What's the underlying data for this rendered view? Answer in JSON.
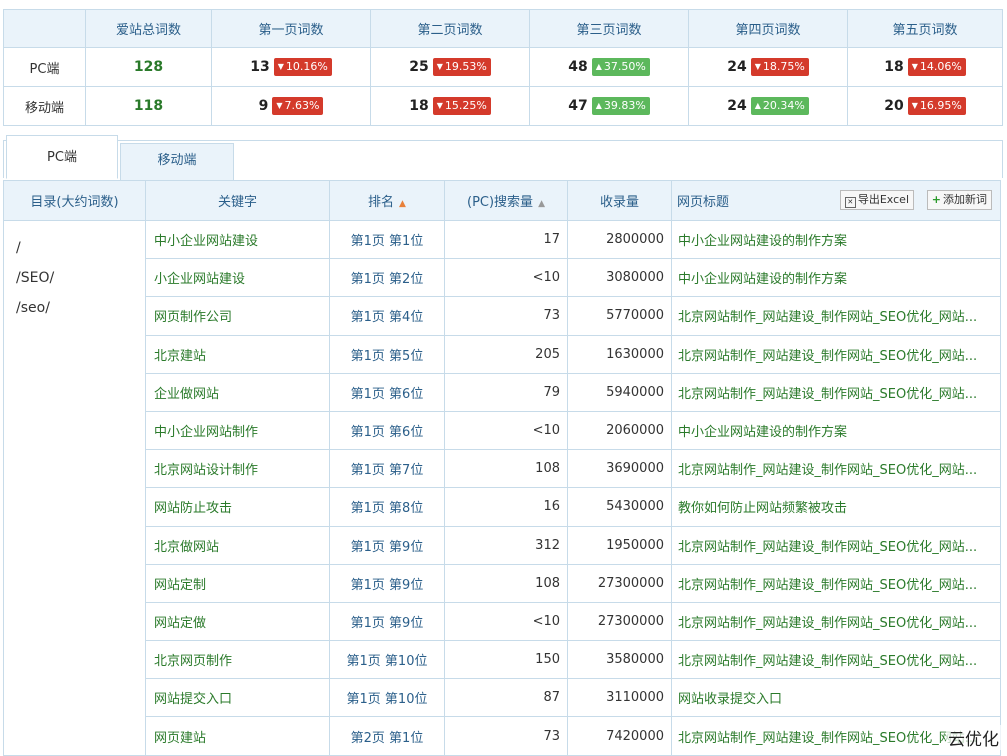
{
  "summary": {
    "headers": [
      "",
      "爱站总词数",
      "第一页词数",
      "第二页词数",
      "第三页词数",
      "第四页词数",
      "第五页词数"
    ],
    "rows": [
      {
        "label": "PC端",
        "total": "128",
        "pages": [
          {
            "count": "13",
            "change": "10.16%",
            "dir": "down"
          },
          {
            "count": "25",
            "change": "19.53%",
            "dir": "down"
          },
          {
            "count": "48",
            "change": "37.50%",
            "dir": "up"
          },
          {
            "count": "24",
            "change": "18.75%",
            "dir": "down"
          },
          {
            "count": "18",
            "change": "14.06%",
            "dir": "down"
          }
        ]
      },
      {
        "label": "移动端",
        "total": "118",
        "pages": [
          {
            "count": "9",
            "change": "7.63%",
            "dir": "down"
          },
          {
            "count": "18",
            "change": "15.25%",
            "dir": "down"
          },
          {
            "count": "47",
            "change": "39.83%",
            "dir": "up"
          },
          {
            "count": "24",
            "change": "20.34%",
            "dir": "up"
          },
          {
            "count": "20",
            "change": "16.95%",
            "dir": "down"
          }
        ]
      }
    ]
  },
  "tabs": [
    {
      "label": "PC端",
      "active": true
    },
    {
      "label": "移动端",
      "active": false
    }
  ],
  "table": {
    "headers": {
      "dir": "目录(大约词数)",
      "keyword": "关键字",
      "rank": "排名",
      "volume": "(PC)搜索量",
      "indexed": "收录量",
      "title": "网页标题"
    },
    "buttons": {
      "export": "导出Excel",
      "add": "添加新词"
    },
    "directories": [
      "/",
      "/SEO/",
      "/seo/"
    ],
    "rows": [
      {
        "keyword": "中小企业网站建设",
        "rank": "第1页 第1位",
        "volume": "17",
        "indexed": "2800000",
        "title": "中小企业网站建设的制作方案"
      },
      {
        "keyword": "小企业网站建设",
        "rank": "第1页 第2位",
        "volume": "<10",
        "indexed": "3080000",
        "title": "中小企业网站建设的制作方案"
      },
      {
        "keyword": "网页制作公司",
        "rank": "第1页 第4位",
        "volume": "73",
        "indexed": "5770000",
        "title": "北京网站制作_网站建设_制作网站_SEO优化_网站..."
      },
      {
        "keyword": "北京建站",
        "rank": "第1页 第5位",
        "volume": "205",
        "indexed": "1630000",
        "title": "北京网站制作_网站建设_制作网站_SEO优化_网站..."
      },
      {
        "keyword": "企业做网站",
        "rank": "第1页 第6位",
        "volume": "79",
        "indexed": "5940000",
        "title": "北京网站制作_网站建设_制作网站_SEO优化_网站..."
      },
      {
        "keyword": "中小企业网站制作",
        "rank": "第1页 第6位",
        "volume": "<10",
        "indexed": "2060000",
        "title": "中小企业网站建设的制作方案"
      },
      {
        "keyword": "北京网站设计制作",
        "rank": "第1页 第7位",
        "volume": "108",
        "indexed": "3690000",
        "title": "北京网站制作_网站建设_制作网站_SEO优化_网站..."
      },
      {
        "keyword": "网站防止攻击",
        "rank": "第1页 第8位",
        "volume": "16",
        "indexed": "5430000",
        "title": "教你如何防止网站频繁被攻击"
      },
      {
        "keyword": "北京做网站",
        "rank": "第1页 第9位",
        "volume": "312",
        "indexed": "1950000",
        "title": "北京网站制作_网站建设_制作网站_SEO优化_网站..."
      },
      {
        "keyword": "网站定制",
        "rank": "第1页 第9位",
        "volume": "108",
        "indexed": "27300000",
        "title": "北京网站制作_网站建设_制作网站_SEO优化_网站..."
      },
      {
        "keyword": "网站定做",
        "rank": "第1页 第9位",
        "volume": "<10",
        "indexed": "27300000",
        "title": "北京网站制作_网站建设_制作网站_SEO优化_网站..."
      },
      {
        "keyword": "北京网页制作",
        "rank": "第1页 第10位",
        "volume": "150",
        "indexed": "3580000",
        "title": "北京网站制作_网站建设_制作网站_SEO优化_网站..."
      },
      {
        "keyword": "网站提交入口",
        "rank": "第1页 第10位",
        "volume": "87",
        "indexed": "3110000",
        "title": "网站收录提交入口"
      },
      {
        "keyword": "网页建站",
        "rank": "第2页 第1位",
        "volume": "73",
        "indexed": "7420000",
        "title": "北京网站制作_网站建设_制作网站_SEO优化_网站..."
      }
    ]
  },
  "watermark": "云优化",
  "colors": {
    "up": "#5cb85c",
    "down": "#d43a2b",
    "header_bg": "#eaf3fa",
    "keyword_green": "#2a7a2a",
    "border": "#c7dbe9"
  }
}
